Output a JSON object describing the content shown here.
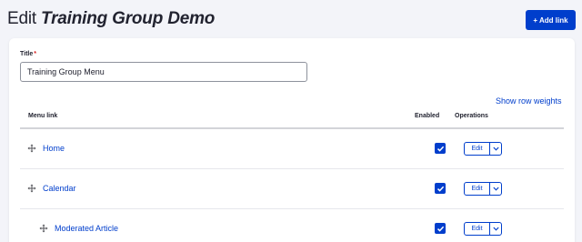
{
  "header": {
    "title_prefix": "Edit",
    "title_emphasis": "Training Group Demo",
    "add_link_label": "+ Add link"
  },
  "form": {
    "title_label": "Title",
    "required_mark": "*",
    "title_value": "Training Group Menu"
  },
  "table": {
    "row_weights_link": "Show row weights",
    "columns": {
      "menu_link": "Menu link",
      "enabled": "Enabled",
      "operations": "Operations"
    },
    "rows": [
      {
        "label": "Home",
        "enabled": true,
        "operation": "Edit",
        "depth": 0
      },
      {
        "label": "Calendar",
        "enabled": true,
        "operation": "Edit",
        "depth": 0
      },
      {
        "label": "Moderated Article",
        "enabled": true,
        "operation": "Edit",
        "depth": 1
      }
    ]
  },
  "colors": {
    "accent": "#003ecc",
    "background": "#f3f4f9",
    "card": "#ffffff",
    "required": "#d72222"
  },
  "icons": {
    "drag": "drag-handle-icon",
    "check": "checkmark-icon",
    "toggle": "chevron-down-icon"
  }
}
